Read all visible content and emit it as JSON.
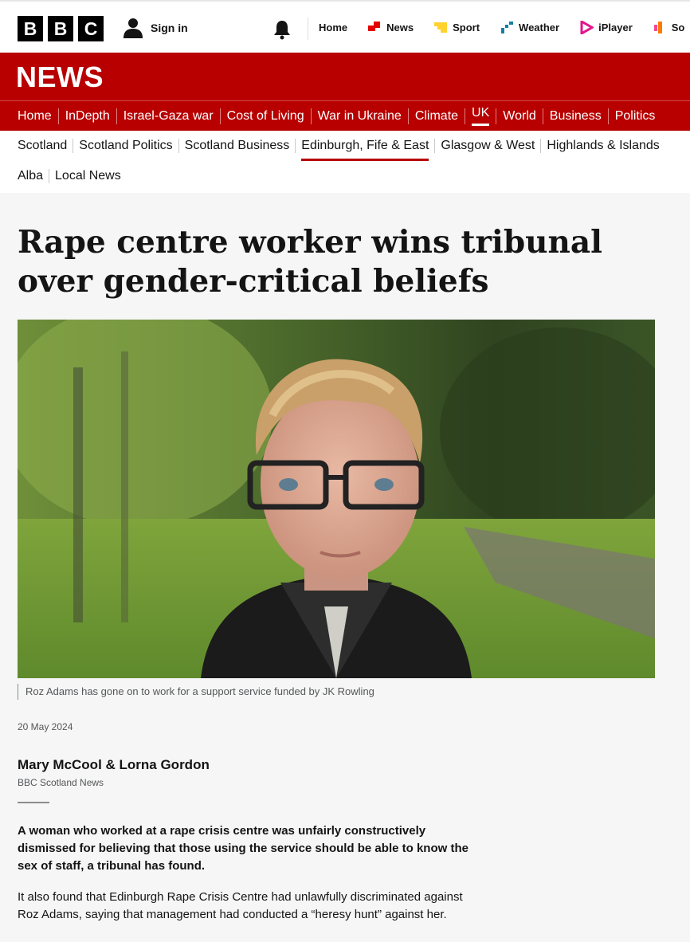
{
  "topbar": {
    "logo_letters": [
      "B",
      "B",
      "C"
    ],
    "sign_in": "Sign in",
    "nav": [
      {
        "label": "Home",
        "icon": "none"
      },
      {
        "label": "News",
        "icon": "news-icon",
        "color": "#e40000"
      },
      {
        "label": "Sport",
        "icon": "sport-icon",
        "color": "#ffd230"
      },
      {
        "label": "Weather",
        "icon": "weather-icon",
        "color": "#1380a1"
      },
      {
        "label": "iPlayer",
        "icon": "iplayer-icon",
        "color": "#e3158e"
      },
      {
        "label": "So",
        "icon": "sounds-icon",
        "color": "#f54997"
      }
    ]
  },
  "news_banner": {
    "label": "NEWS",
    "color": "#b80000"
  },
  "section_nav": [
    "Home",
    "InDepth",
    "Israel-Gaza war",
    "Cost of Living",
    "War in Ukraine",
    "Climate",
    "UK",
    "World",
    "Business",
    "Politics"
  ],
  "section_nav_active": "UK",
  "sub_nav": [
    "Scotland",
    "Scotland Politics",
    "Scotland Business",
    "Edinburgh, Fife & East",
    "Glasgow & West",
    "Highlands & Islands",
    "Alba",
    "Local News"
  ],
  "sub_nav_active": "Edinburgh, Fife & East",
  "article": {
    "headline": "Rape centre worker wins tribunal over gender-critical beliefs",
    "image_caption": "Roz Adams has gone on to work for a support service funded by JK Rowling",
    "date": "20 May 2024",
    "authors": "Mary McCool & Lorna Gordon",
    "organisation": "BBC Scotland News",
    "intro": "A woman who worked at a rape crisis centre was unfairly constructively dismissed for believing that those using the service should be able to know the sex of staff, a tribunal has found.",
    "paragraph_1": "It also found that Edinburgh Rape Crisis Centre had unlawfully discriminated against Roz Adams, saying that management had conducted a “heresy hunt” against her."
  }
}
